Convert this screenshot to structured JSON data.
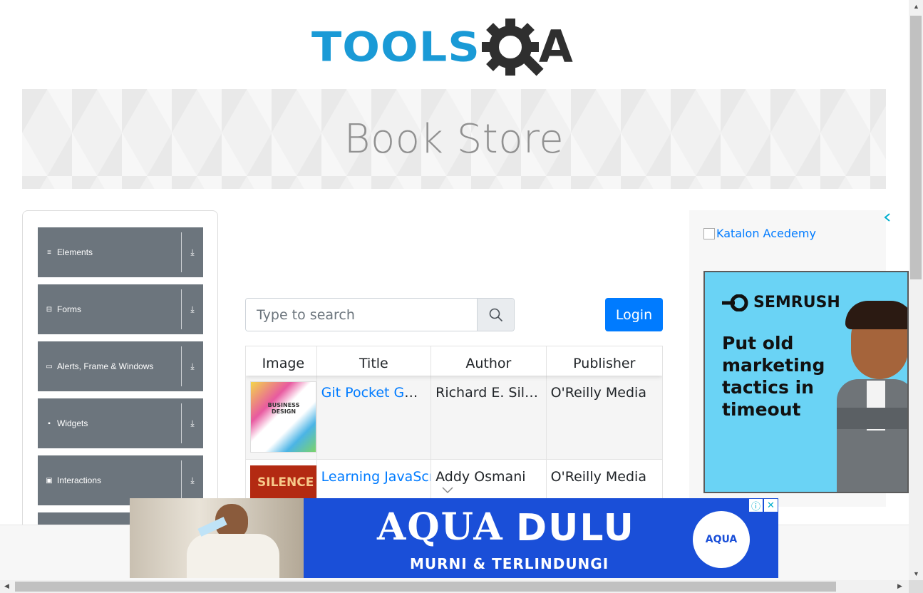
{
  "logo": {
    "text": "TOOLS",
    "tail": "A"
  },
  "banner": {
    "title": "Book Store"
  },
  "sidebar": {
    "groups": [
      {
        "label": "Elements",
        "icon": "list-icon",
        "glyph": "≡"
      },
      {
        "label": "Forms",
        "icon": "form-icon",
        "glyph": "⊟"
      },
      {
        "label": "Alerts, Frame & Windows",
        "icon": "window-icon",
        "glyph": "▭"
      },
      {
        "label": "Widgets",
        "icon": "widgets-icon",
        "glyph": "▪"
      },
      {
        "label": "Interactions",
        "icon": "interactions-icon",
        "glyph": "▣"
      }
    ],
    "expand_glyph": "⤓"
  },
  "search": {
    "placeholder": "Type to search"
  },
  "login": {
    "label": "Login"
  },
  "table": {
    "headers": [
      "Image",
      "Title",
      "Author",
      "Publisher"
    ],
    "rows": [
      {
        "title": "Git Pocket Guide",
        "author": "Richard E. Silverman",
        "publisher": "O'Reilly Media",
        "cover_text": "BUSINESS DESIGN"
      },
      {
        "title": "Learning JavaScript Design Patterns",
        "author": "Addy Osmani",
        "publisher": "O'Reilly Media",
        "cover_text": "SILENCE"
      }
    ]
  },
  "right_ad": {
    "link_text": "Katalon Acedemy",
    "brand": "SEMRUSH",
    "copy": "Put old marketing tactics in timeout"
  },
  "bottom_ad": {
    "headline_1": "AQUA",
    "headline_2": "DULU",
    "tagline": "MURNI & TERLINDUNGI",
    "badge": "AQUA",
    "info": "ⓘ",
    "close": "✕"
  },
  "colors": {
    "brand_blue": "#1a9ad6",
    "button_blue": "#007bff",
    "sidebar_gray": "#6c757d"
  }
}
